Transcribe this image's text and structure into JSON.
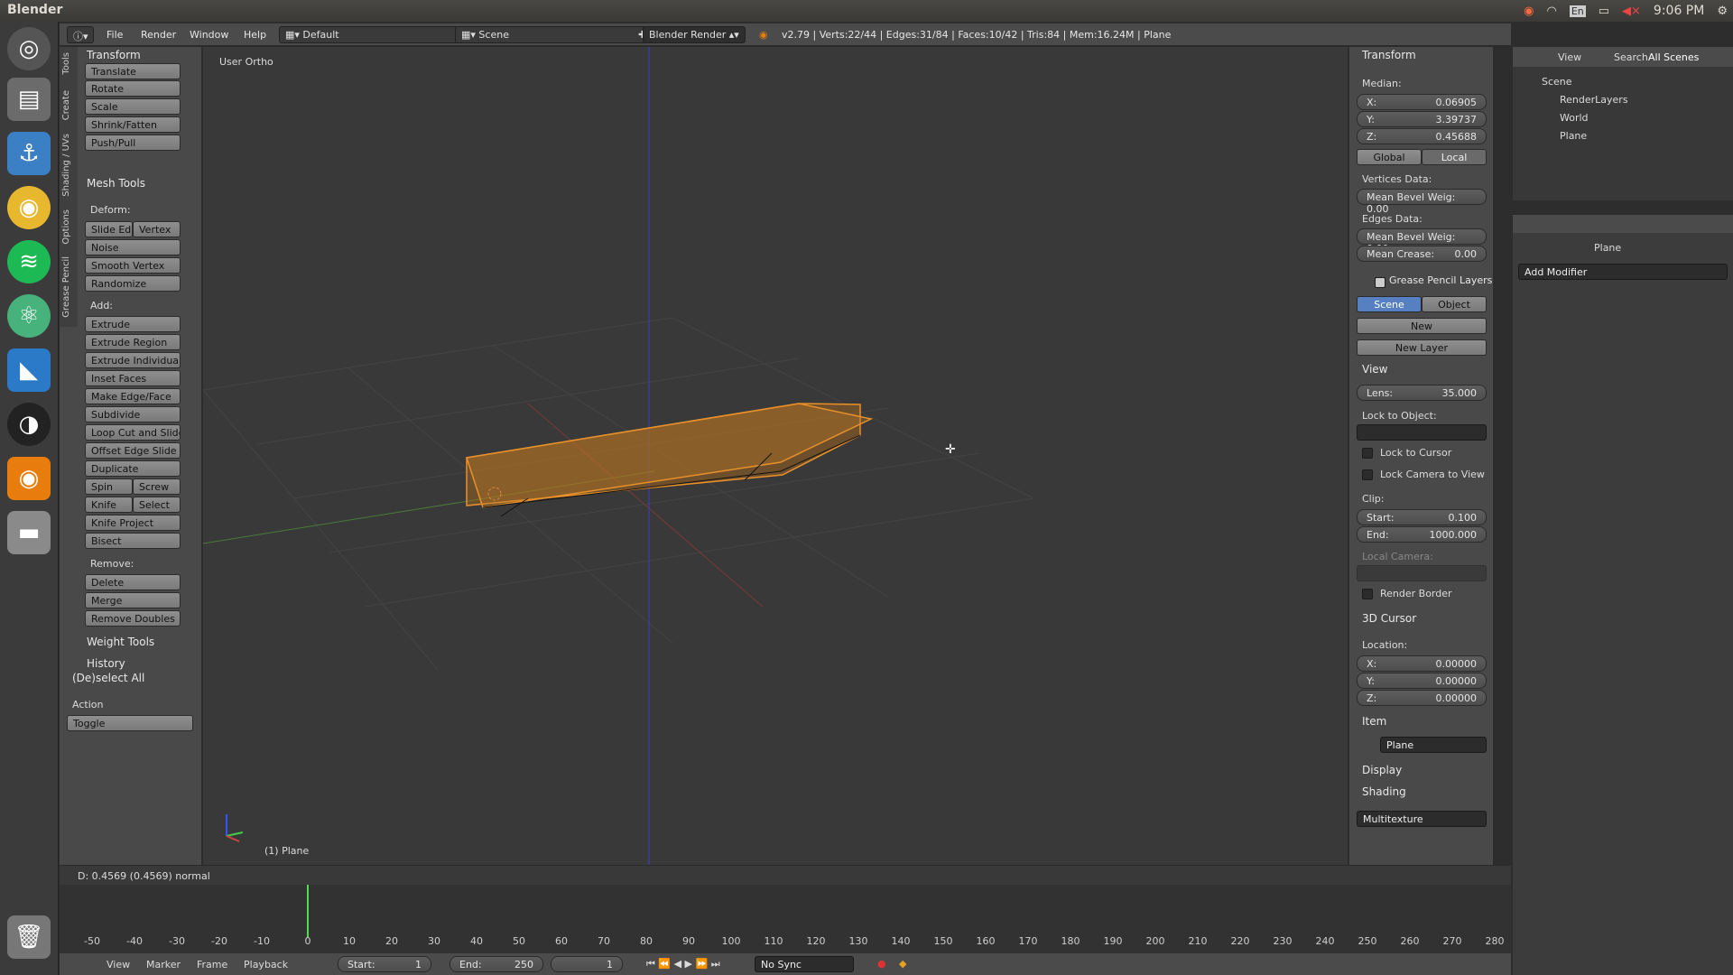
{
  "system": {
    "app_name": "Blender",
    "clock": "9:06 PM",
    "lang": "En"
  },
  "header": {
    "menus": [
      "File",
      "Render",
      "Window",
      "Help"
    ],
    "layout": "Default",
    "scene": "Scene",
    "engine": "Blender Render",
    "stats": "v2.79 | Verts:22/44 | Edges:31/84 | Faces:10/42 | Tris:84 | Mem:16.24M | Plane"
  },
  "tool_tabs": [
    "Tools",
    "Create",
    "Shading / UVs",
    "Options",
    "Grease Pencil"
  ],
  "tools": {
    "transform": {
      "title": "Transform",
      "buttons": [
        "Translate",
        "Rotate",
        "Scale",
        "Shrink/Fatten",
        "Push/Pull"
      ]
    },
    "mesh_tools": {
      "title": "Mesh Tools",
      "deform_label": "Deform:",
      "slide_edge": "Slide Ed",
      "vertex": "Vertex",
      "noise": "Noise",
      "smooth_vertex": "Smooth Vertex",
      "randomize": "Randomize",
      "add_label": "Add:",
      "extrude": "Extrude",
      "add_buttons": [
        "Extrude Region",
        "Extrude Individual",
        "Inset Faces",
        "Make Edge/Face",
        "Subdivide",
        "Loop Cut and Slide",
        "Offset Edge Slide",
        "Duplicate"
      ],
      "spin": "Spin",
      "screw": "Screw",
      "knife": "Knife",
      "select": "Select",
      "knife_project": "Knife Project",
      "bisect": "Bisect",
      "remove_label": "Remove:",
      "delete": "Delete",
      "merge": "Merge",
      "remove_doubles": "Remove Doubles"
    },
    "weight_tools": "Weight Tools",
    "history": "History",
    "operator": {
      "title": "(De)select All",
      "action_label": "Action",
      "action_value": "Toggle"
    }
  },
  "viewport": {
    "view_name": "User Ortho",
    "object_label": "(1) Plane"
  },
  "properties": {
    "transform_title": "Transform",
    "median": "Median:",
    "x_label": "X:",
    "x": "0.06905",
    "y_label": "Y:",
    "y": "3.39737",
    "z_label": "Z:",
    "z": "0.45688",
    "global": "Global",
    "local": "Local",
    "vertices_data": "Vertices Data:",
    "mean_bevel_v": "Mean Bevel Weig: 0.00",
    "edges_data": "Edges Data:",
    "mean_bevel_e": "Mean Bevel Weig: 0.00",
    "mean_crease_label": "Mean Crease:",
    "mean_crease": "0.00",
    "grease_title": "Grease Pencil Layers",
    "gp_scene": "Scene",
    "gp_object": "Object",
    "gp_new": "New",
    "gp_new_layer": "New Layer",
    "view_title": "View",
    "lens_label": "Lens:",
    "lens": "35.000",
    "lock_object": "Lock to Object:",
    "lock_cursor": "Lock to Cursor",
    "lock_camera": "Lock Camera to View",
    "clip": "Clip:",
    "start_label": "Start:",
    "start": "0.100",
    "end_label": "End:",
    "end": "1000.000",
    "local_camera": "Local Camera:",
    "render_border": "Render Border",
    "cursor_title": "3D Cursor",
    "location": "Location:",
    "cx": "0.00000",
    "cy": "0.00000",
    "cz": "0.00000",
    "item_title": "Item",
    "item_name": "Plane",
    "display_title": "Display",
    "shading_title": "Shading",
    "shading_value": "Multitexture"
  },
  "outliner": {
    "view": "View",
    "search": "Search",
    "all_scenes": "All Scenes",
    "items": [
      "Scene",
      "RenderLayers",
      "World",
      "Plane"
    ]
  },
  "modifiers": {
    "object": "Plane",
    "add": "Add Modifier"
  },
  "status": "D: 0.4569 (0.4569) normal",
  "timeline": {
    "ticks": [
      "-50",
      "-40",
      "-30",
      "-20",
      "-10",
      "0",
      "10",
      "20",
      "30",
      "40",
      "50",
      "60",
      "70",
      "80",
      "90",
      "100",
      "110",
      "120",
      "130",
      "140",
      "150",
      "160",
      "170",
      "180",
      "190",
      "200",
      "210",
      "220",
      "230",
      "240",
      "250",
      "260",
      "270",
      "280"
    ],
    "menus": [
      "View",
      "Marker",
      "Frame",
      "Playback"
    ],
    "start_label": "Start:",
    "start": "1",
    "end_label": "End:",
    "end": "250",
    "current": "1",
    "sync": "No Sync"
  }
}
